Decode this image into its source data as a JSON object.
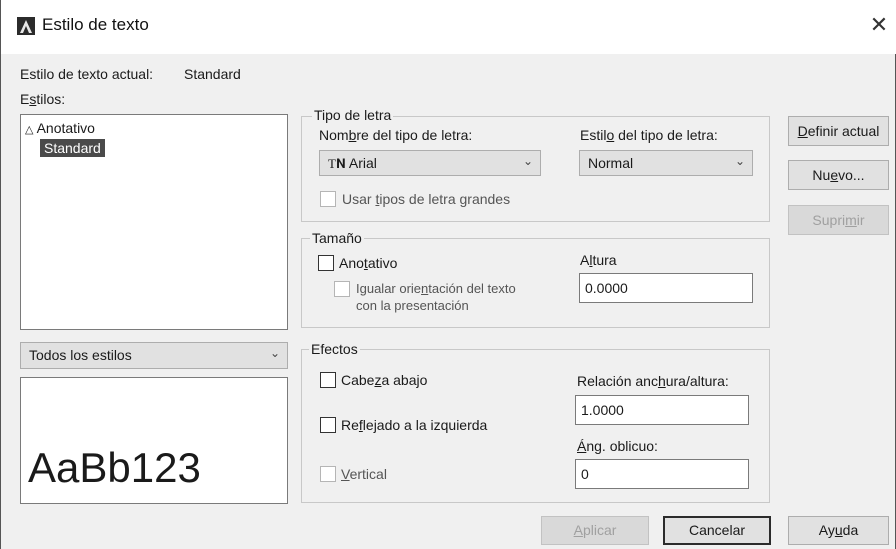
{
  "window": {
    "title": "Estilo de texto",
    "close_glyph": "✕"
  },
  "current_style": {
    "label": "Estilo de texto actual:",
    "value": "Standard"
  },
  "styles": {
    "label_pre": "E",
    "label_ul": "s",
    "label_post": "tilos:",
    "items": [
      {
        "label": "Anotativo",
        "icon": "annotative-icon",
        "selected": false
      },
      {
        "label": "Standard",
        "icon": "",
        "selected": true
      }
    ],
    "filter": {
      "value": "Todos los estilos"
    },
    "preview": "AaBb123"
  },
  "font_group": {
    "title": "Tipo de letra",
    "name_label_pre": "Nom",
    "name_label_ul": "b",
    "name_label_post": "re del tipo de letra:",
    "name_value": "Arial",
    "name_icon": "truetype-icon",
    "style_label_pre": "Estil",
    "style_label_ul": "o",
    "style_label_post": " del tipo de letra:",
    "style_value": "Normal",
    "big_font_pre": "Usar ",
    "big_font_ul": "t",
    "big_font_post": "ipos de letra grandes"
  },
  "size_group": {
    "title": "Tamaño",
    "annotative_pre": "Ano",
    "annotative_ul": "t",
    "annotative_post": "ativo",
    "match_pre": "Igualar orie",
    "match_ul": "n",
    "match_post": "tación del texto",
    "match_line2": "con la presentación",
    "height_label_pre": "A",
    "height_label_ul": "l",
    "height_label_post": "tura",
    "height_value": "0.0000"
  },
  "effects_group": {
    "title": "Efectos",
    "upside_pre": "Cabe",
    "upside_ul": "z",
    "upside_post": "a abajo",
    "backwards_pre": "Re",
    "backwards_ul": "f",
    "backwards_post": "lejado a la izquierda",
    "vertical_ul": "V",
    "vertical_post": "ertical",
    "width_label_pre": "Relación anc",
    "width_label_ul": "h",
    "width_label_post": "ura/altura:",
    "width_value": "1.0000",
    "oblique_label_ul": "Á",
    "oblique_label_post": "ng. oblicuo:",
    "oblique_value": "0"
  },
  "buttons": {
    "set_current_ul": "D",
    "set_current_post": "efinir actual",
    "new_pre": "Nu",
    "new_ul": "e",
    "new_post": "vo...",
    "delete_pre": "Supri",
    "delete_ul": "m",
    "delete_post": "ir",
    "apply_ul": "A",
    "apply_post": "plicar",
    "cancel": "Cancelar",
    "help_pre": "Ay",
    "help_ul": "u",
    "help_post": "da"
  }
}
